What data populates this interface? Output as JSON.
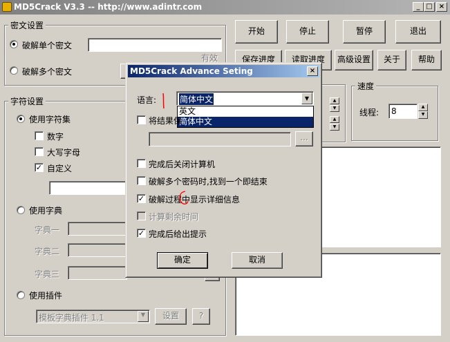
{
  "window": {
    "title": "MD5Crack V3.3 -- http://www.adintr.com",
    "min": "_",
    "max": "□",
    "close": "×"
  },
  "cipher": {
    "group_label": "密文设置",
    "single_label": "破解单个密文",
    "multi_label": "破解多个密文",
    "validity": "有效"
  },
  "charset": {
    "group_label": "字符设置",
    "use_charset": "使用字符集",
    "digits": "数字",
    "upper": "大写字母",
    "custom": "自定义",
    "use_dict": "使用字典",
    "dict1": "字典一",
    "dict2": "字典二",
    "dict3": "字典三",
    "use_plugin": "使用插件",
    "plugin_value": "模板字典插件 1.1",
    "settings": "设置",
    "help": "?"
  },
  "toolbar": {
    "start": "开始",
    "stop": "停止",
    "pause": "暂停",
    "exit": "退出",
    "save": "保存进度",
    "load": "读取进度",
    "advanced": "高级设置",
    "about": "关于",
    "help": "帮助"
  },
  "speed": {
    "group_label": "速度",
    "threads_label": "线程:",
    "threads_value": "8"
  },
  "dialog": {
    "title": "MD5Crack Advance Seting",
    "close": "×",
    "language_label": "语言:",
    "language_value": "简体中文",
    "language_options": [
      "英文",
      "简体中文"
    ],
    "save_result_label": "将结果保",
    "browse": "...",
    "shutdown": "完成后关闭计算机",
    "stop_on_first": "破解多个密码时,找到一个即结束",
    "show_details": "破解过程中显示详细信息",
    "calc_remaining": "计算剩余时间",
    "notify_done": "完成后给出提示",
    "ok": "确定",
    "cancel": "取消"
  },
  "colors": {
    "face": "#d4d0c8",
    "active_title": "#0a246a",
    "inactive_title": "#808080",
    "annotation": "#ff0000"
  }
}
